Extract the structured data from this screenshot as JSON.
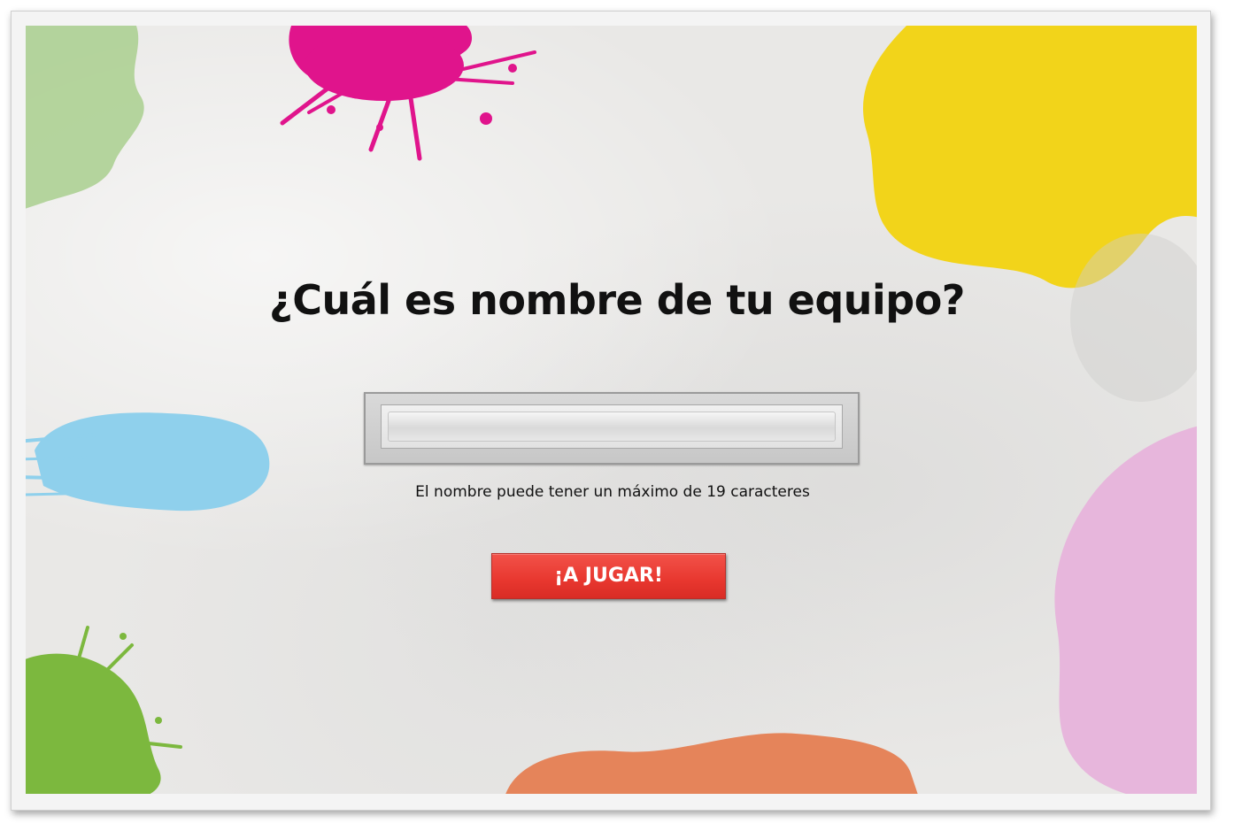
{
  "screen": {
    "title": "¿Cuál es nombre de tu equipo?",
    "team_name_input": {
      "value": "",
      "placeholder": ""
    },
    "hint": "El nombre puede tener un máximo de 19 caracteres",
    "play_button_label": "¡A JUGAR!"
  },
  "colors": {
    "paint_magenta": "#e0148c",
    "paint_yellow": "#f2d41a",
    "paint_light_green": "#a9cf8e",
    "paint_blue": "#8fd0ec",
    "paint_green": "#7cb83e",
    "paint_orange": "#e5845a",
    "paint_pink": "#e7b6dc",
    "button_red": "#e8372f"
  }
}
